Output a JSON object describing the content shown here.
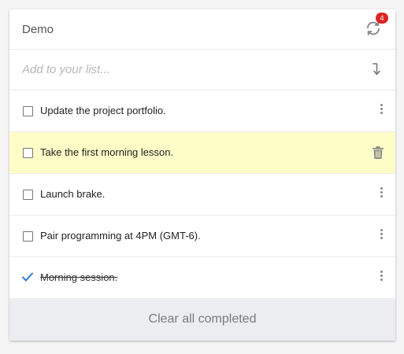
{
  "header": {
    "title": "Demo",
    "sync_icon": "refresh-icon",
    "badge_count": "4",
    "badge_color": "#e02424"
  },
  "add_item": {
    "placeholder": "Add to your list...",
    "value": "",
    "enter_icon": "return-arrow-icon"
  },
  "items": [
    {
      "label": "Update the project portfolio.",
      "completed": false,
      "action_icon": "more-vertical-icon"
    },
    {
      "label": "Take the first morning lesson.",
      "completed": false,
      "hovered": true,
      "action_icon": "trash-icon"
    },
    {
      "label": "Launch brake.",
      "completed": false,
      "action_icon": "more-vertical-icon"
    },
    {
      "label": "Pair programming at 4PM (GMT-6).",
      "completed": false,
      "action_icon": "more-vertical-icon"
    },
    {
      "label": "Morning session.",
      "completed": true,
      "action_icon": "more-vertical-icon"
    }
  ],
  "footer": {
    "clear_label": "Clear all completed"
  },
  "colors": {
    "hover_row": "#fefdc8",
    "checkmark": "#2f7bd1",
    "footer_bg": "#ecedf0"
  }
}
